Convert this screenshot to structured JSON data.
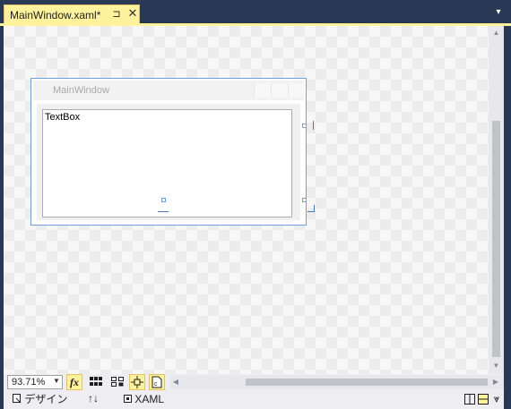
{
  "tab": {
    "title": "MainWindow.xaml*",
    "pin_glyph": "⊐",
    "close_glyph": "✕",
    "dropdown_glyph": "▾"
  },
  "designer": {
    "window_title": "MainWindow",
    "textbox_text": "TextBox"
  },
  "toolbar": {
    "zoom_value": "93.71%",
    "fx_label": "fx",
    "grid_icon": "grid-icon",
    "snap_grid_icon": "snap-to-gridlines-icon",
    "snap_lines_icon": "snap-to-snaplines-icon",
    "project_code_icon": "project-code-icon"
  },
  "view_tabs": {
    "design_label": "デザイン",
    "swap_label": "↑↓",
    "xaml_label": "XAML"
  },
  "colors": {
    "tab_active": "#FFF29D",
    "chrome": "#293955",
    "selection": "#6f9fe0"
  }
}
